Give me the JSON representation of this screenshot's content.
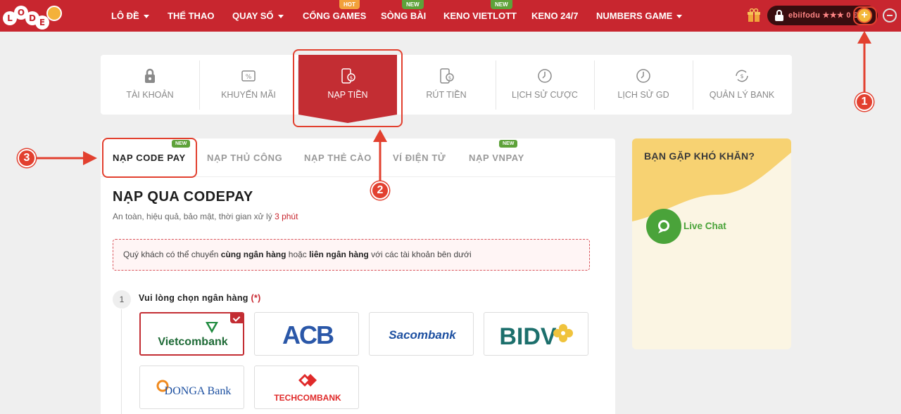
{
  "brand": {
    "logo_letters": [
      "L",
      "O",
      "D",
      "E"
    ]
  },
  "nav": {
    "items": [
      {
        "label": "LÔ ĐỀ",
        "dropdown": true,
        "badge": ""
      },
      {
        "label": "THỂ THAO",
        "dropdown": false,
        "badge": ""
      },
      {
        "label": "QUAY SỐ",
        "dropdown": true,
        "badge": ""
      },
      {
        "label": "CỔNG GAMES",
        "dropdown": false,
        "badge": "HOT"
      },
      {
        "label": "SÒNG BÀI",
        "dropdown": false,
        "badge": "NEW"
      },
      {
        "label": "KENO VIETLOTT",
        "dropdown": false,
        "badge": "NEW"
      },
      {
        "label": "KENO 24/7",
        "dropdown": false,
        "badge": ""
      },
      {
        "label": "NUMBERS GAME",
        "dropdown": true,
        "badge": ""
      }
    ],
    "user": {
      "name": "ebiifodu",
      "balance": "0 Đ",
      "deposit_symbol": "+"
    }
  },
  "account_tabs": [
    {
      "label": "TÀI KHOẢN",
      "icon": "account-icon"
    },
    {
      "label": "KHUYẾN MÃI",
      "icon": "promotion-icon"
    },
    {
      "label": "NẠP TIỀN",
      "icon": "deposit-icon",
      "active": true
    },
    {
      "label": "RÚT TIỀN",
      "icon": "withdraw-icon"
    },
    {
      "label": "LỊCH SỬ CƯỢC",
      "icon": "clock-icon"
    },
    {
      "label": "LỊCH SỬ GD",
      "icon": "clock-icon"
    },
    {
      "label": "QUẢN LÝ BANK",
      "icon": "bank-exchange-icon"
    }
  ],
  "deposit_methods": [
    {
      "label": "NẠP CODE PAY",
      "badge": "NEW",
      "active": true
    },
    {
      "label": "NẠP THỦ CÔNG",
      "badge": ""
    },
    {
      "label": "NẠP THẺ CÀO",
      "badge": ""
    },
    {
      "label": "VÍ ĐIỆN TỬ",
      "badge": ""
    },
    {
      "label": "NẠP VNPAY",
      "badge": "NEW"
    }
  ],
  "codepay": {
    "title": "NẠP QUA CODEPAY",
    "subtitle_prefix": "An toàn, hiệu quả, bảo mật, thời gian xử lý",
    "subtitle_time": "3 phút",
    "notice_1": "Quý khách có thể chuyển",
    "notice_bold_1": "cùng ngân hàng",
    "notice_2": "hoặc",
    "notice_bold_2": "liên ngân hàng",
    "notice_3": "với các tài khoản bên dưới",
    "step_number": "1",
    "step_label": "Vui lòng chọn ngân hàng",
    "required_mark": "(*)",
    "banks": [
      {
        "name": "Vietcombank",
        "selected": true
      },
      {
        "name": "ACB"
      },
      {
        "name": "Sacombank"
      },
      {
        "name": "BIDV"
      },
      {
        "name": "DONGA Bank"
      },
      {
        "name": "TECHCOMBANK"
      }
    ]
  },
  "help": {
    "title": "BẠN GẶP KHÓ KHĂN?",
    "live_chat": "Live Chat"
  },
  "annotations": [
    "1",
    "2",
    "3"
  ],
  "colors": {
    "brand_red": "#c8262f",
    "annotation_red": "#e2402f",
    "live_chat_green": "#4aa33a"
  }
}
